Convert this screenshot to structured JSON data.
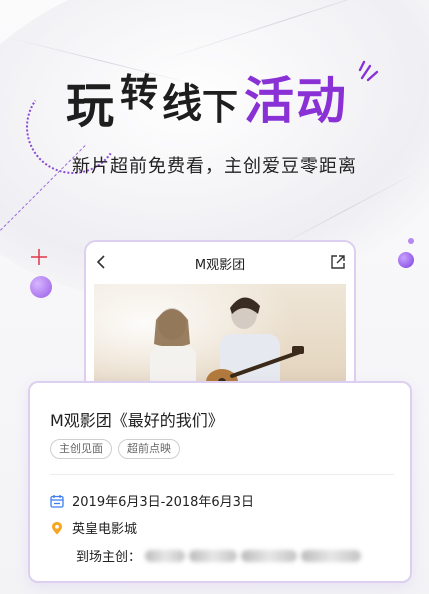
{
  "headline": {
    "part1": "玩",
    "part2": "转",
    "part3": "线",
    "part4": "下",
    "highlight": "活动"
  },
  "subtitle": "新片超前免费看，主创爱豆零距离",
  "phone": {
    "nav_title": "M观影团",
    "back_icon": "chevron-left-icon",
    "share_icon": "share-icon"
  },
  "event": {
    "title": "M观影团《最好的我们》",
    "tags": [
      "主创见面",
      "超前点映"
    ],
    "date": "2019年6月3日-2018年6月3日",
    "place": "英皇电影城",
    "guest_label": "到场主创："
  },
  "colors": {
    "accent": "#8a31d6",
    "card_border": "#dccff0",
    "icon_blue": "#3d7ef2",
    "icon_orange": "#f5a623"
  }
}
